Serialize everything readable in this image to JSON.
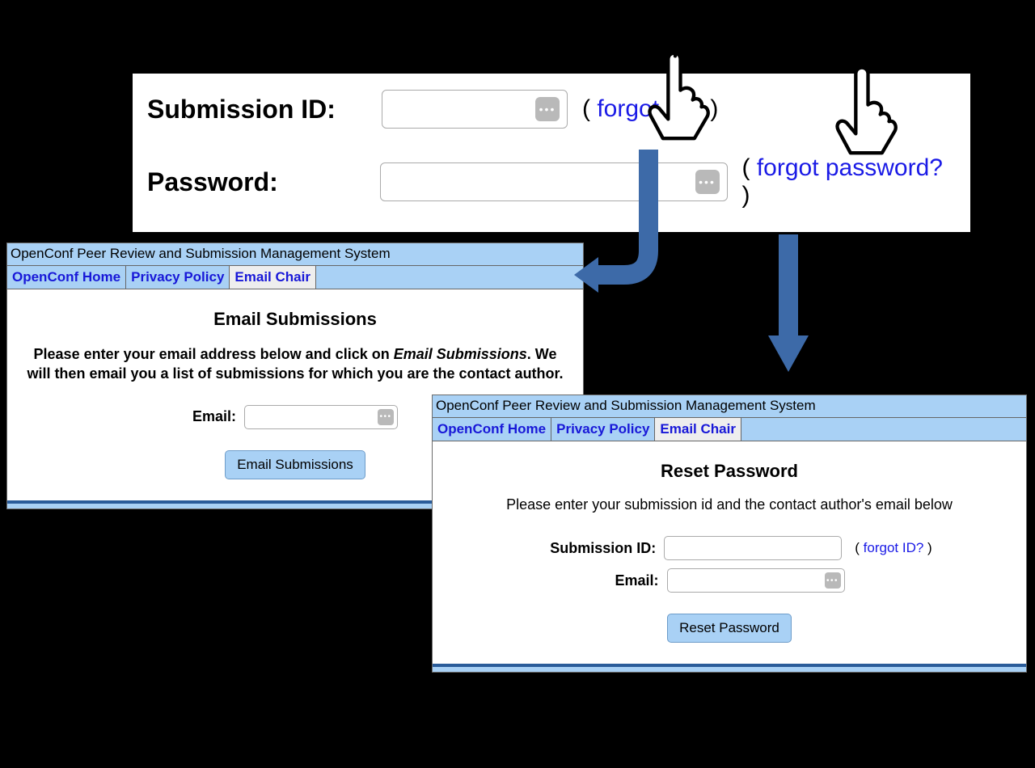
{
  "signin": {
    "sid_label": "Submission ID:",
    "pw_label": "Password:",
    "forgot_id": "forgot ID?",
    "forgot_pw": "forgot password?"
  },
  "panel1": {
    "banner": "OpenConf Peer Review and Submission Management System",
    "nav": {
      "home": "OpenConf Home",
      "privacy": "Privacy Policy",
      "chair": "Email Chair"
    },
    "heading": "Email Submissions",
    "instr_a": "Please enter your email address below and click on ",
    "instr_em": "Email Submissions",
    "instr_b": ". We will then email you a list of submissions for which you are the contact author.",
    "email_label": "Email:",
    "button": "Email Submissions"
  },
  "panel2": {
    "banner": "OpenConf Peer Review and Submission Management System",
    "nav": {
      "home": "OpenConf Home",
      "privacy": "Privacy Policy",
      "chair": "Email Chair"
    },
    "heading": "Reset Password",
    "instr": "Please enter your submission id and the contact author's email below",
    "sid_label": "Submission ID:",
    "email_label": "Email:",
    "forgot_id": "forgot ID?",
    "button": "Reset Password"
  }
}
